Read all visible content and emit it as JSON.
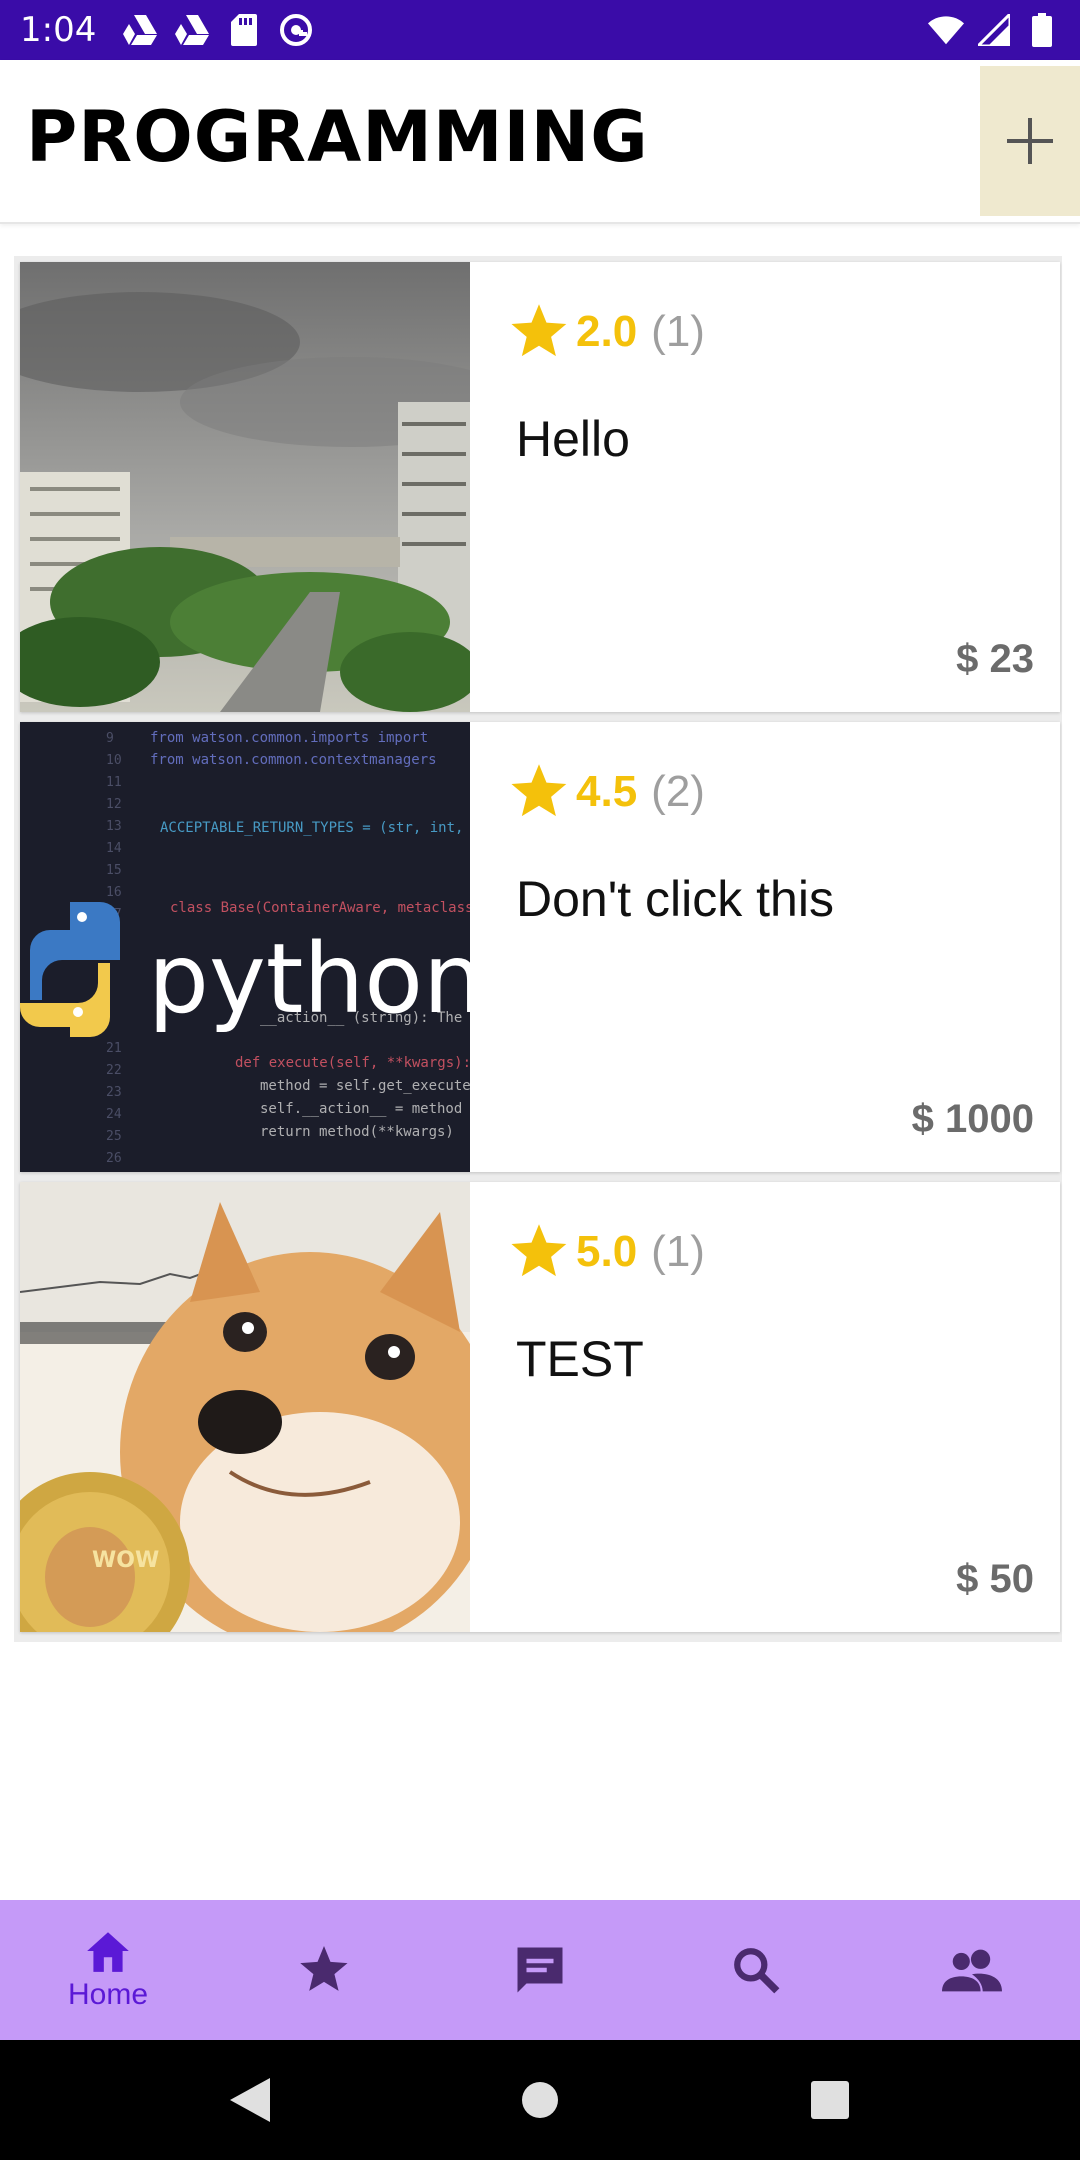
{
  "status_bar": {
    "time": "1:04",
    "left_icons": [
      "drive-icon",
      "drive-icon",
      "sd-card-icon",
      "at-sign-icon"
    ],
    "right_icons": [
      "wifi-icon",
      "signal-icon",
      "battery-icon"
    ]
  },
  "app_bar": {
    "title": "PROGRAMMING",
    "add_label": "+",
    "add_bg": "#efe9cf"
  },
  "cards": [
    {
      "rating": "2.0",
      "count": "(1)",
      "title": "Hello",
      "price": "$ 23",
      "image": "cloudy-city-photo"
    },
    {
      "rating": "4.5",
      "count": "(2)",
      "title": "Don't click this",
      "price": "$ 1000",
      "image": "python-code-photo",
      "image_text": "python"
    },
    {
      "rating": "5.0",
      "count": "(1)",
      "title": "TEST",
      "price": "$ 50",
      "image": "doge-photo",
      "image_text": "WOW"
    }
  ],
  "bottom_nav": {
    "items": [
      {
        "name": "home",
        "label": "Home",
        "icon": "home-icon",
        "active": true
      },
      {
        "name": "favorites",
        "label": "",
        "icon": "star-icon",
        "active": false
      },
      {
        "name": "messages",
        "label": "",
        "icon": "chat-icon",
        "active": false
      },
      {
        "name": "search",
        "label": "",
        "icon": "search-icon",
        "active": false
      },
      {
        "name": "people",
        "label": "",
        "icon": "people-icon",
        "active": false
      }
    ]
  },
  "colors": {
    "status_bar": "#3a0ca8",
    "accent": "#5b19d6",
    "bottom_nav": "#c59af8",
    "star": "#f4c10b",
    "price": "#6b6b6b"
  }
}
